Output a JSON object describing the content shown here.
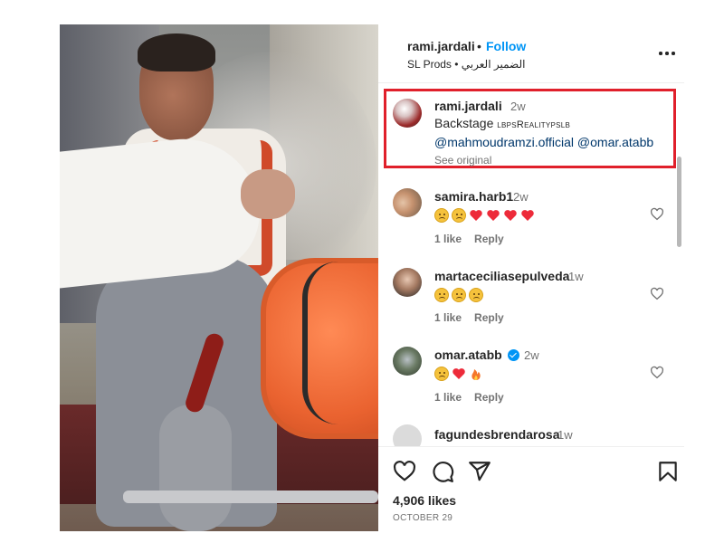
{
  "post": {
    "owner": "rami.jardali",
    "separator": "•",
    "follow_label": "Follow",
    "sub_line": "SL Prods • الضمير العربي"
  },
  "caption": {
    "user": "rami.jardali",
    "time": "2w",
    "text_prefix": "Backstage ",
    "stylized": "lbpsRealitypslb",
    "mention_1": "@mahmoudramzi.official",
    "mention_2": "@omar.atabb",
    "see_original": "See original"
  },
  "comments": [
    {
      "user": "samira.harb1",
      "time": "2w",
      "emoji": [
        "sad",
        "sad",
        "heart",
        "heart",
        "heart",
        "heart"
      ],
      "likes": "1 like",
      "reply": "Reply"
    },
    {
      "user": "martaceciliasepulveda",
      "time": "1w",
      "emoji": [
        "sad",
        "sad",
        "sad"
      ],
      "likes": "1 like",
      "reply": "Reply"
    },
    {
      "user": "omar.atabb",
      "time": "2w",
      "verified": true,
      "emoji": [
        "sad",
        "heart",
        "fire"
      ],
      "likes": "1 like",
      "reply": "Reply"
    },
    {
      "user": "fagundesbrendarosa",
      "time": "1w"
    }
  ],
  "footer": {
    "likes": "4,906 likes",
    "date": "OCTOBER 29"
  },
  "icons": {
    "like": "heart-outline-icon",
    "comment": "comment-bubble-icon",
    "share": "paper-plane-icon",
    "save": "bookmark-icon",
    "more": "more-horizontal-icon"
  },
  "colors": {
    "accent": "#0095f6",
    "highlight_border": "#e0202b",
    "heart": "#ed2b3a"
  }
}
